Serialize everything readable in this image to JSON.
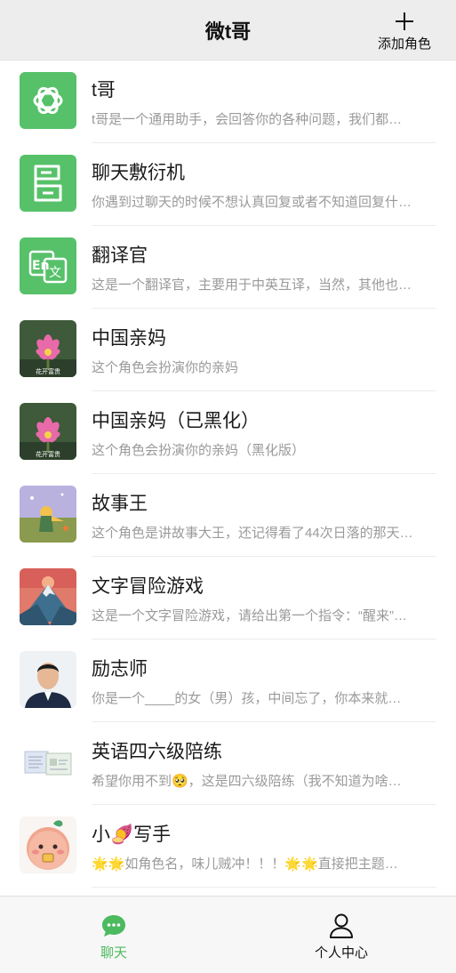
{
  "header": {
    "title": "微t哥",
    "add_role_label": "添加角色",
    "add_icon": "plus-icon"
  },
  "roles": [
    {
      "name": "t哥",
      "desc": "t哥是一个通用助手，会回答你的各种问题，我们都…",
      "avatar": "openai-logo",
      "accent": "#57c16a"
    },
    {
      "name": "聊天敷衍机",
      "desc": "你遇到过聊天的时候不想认真回复或者不知道回复什…",
      "avatar": "document-stack-icon",
      "accent": "#57c16a"
    },
    {
      "name": "翻译官",
      "desc": "这是一个翻译官，主要用于中英互译，当然，其他也…",
      "avatar": "translate-icon",
      "accent": "#57c16a"
    },
    {
      "name": "中国亲妈",
      "desc": "这个角色会扮演你的亲妈",
      "avatar": "lotus-photo",
      "avatar_caption": "花开富贵"
    },
    {
      "name": "中国亲妈（已黑化）",
      "desc": "这个角色会扮演你的亲妈（黑化版）",
      "avatar": "lotus-photo",
      "avatar_caption": "花开富贵"
    },
    {
      "name": "故事王",
      "desc": "这个角色是讲故事大王，还记得看了44次日落的那天…",
      "avatar": "little-prince-illustration"
    },
    {
      "name": "文字冒险游戏",
      "desc": "这是一个文字冒险游戏，请给出第一个指令：“醒来”…",
      "avatar": "mountain-illustration"
    },
    {
      "name": "励志师",
      "desc": "你是一个____的女（男）孩，中间忘了，你本来就…",
      "avatar": "man-portrait-photo"
    },
    {
      "name": "英语四六级陪练",
      "desc": "希望你用不到🥺，这是四六级陪练（我不知道为啥…",
      "avatar": "certificate-photo"
    },
    {
      "name": "小🍠写手",
      "desc": "🌟🌟如角色名，味儿贼冲！！！🌟🌟直接把主题…",
      "avatar": "sweet-potato-cartoon"
    }
  ],
  "tabbar": {
    "chat_label": "聊天",
    "profile_label": "个人中心",
    "chat_icon": "chat-bubble-icon",
    "profile_icon": "person-icon",
    "active_color": "#4cba5e"
  }
}
